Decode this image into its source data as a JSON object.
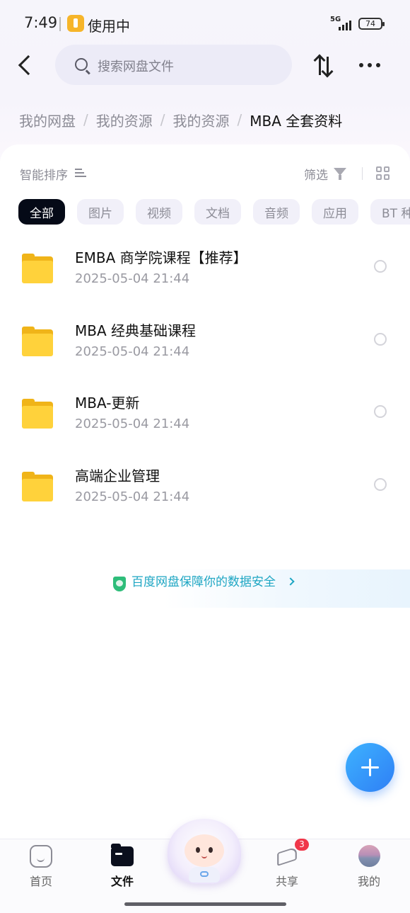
{
  "status_bar": {
    "time": "7:49",
    "app_label": "使用中",
    "network": "5G",
    "battery": "74"
  },
  "header": {
    "search_placeholder": "搜索网盘文件"
  },
  "breadcrumb": [
    "我的网盘",
    "我的资源",
    "我的资源",
    "MBA 全套资料"
  ],
  "toolbar": {
    "sort_label": "智能排序",
    "filter_label": "筛选"
  },
  "chips": [
    "全部",
    "图片",
    "视频",
    "文档",
    "音频",
    "应用",
    "BT 种"
  ],
  "files": [
    {
      "name": "EMBA 商学院课程【推荐】",
      "date": "2025-05-04  21:44"
    },
    {
      "name": "MBA 经典基础课程",
      "date": "2025-05-04  21:44"
    },
    {
      "name": "MBA-更新",
      "date": "2025-05-04  21:44"
    },
    {
      "name": "高端企业管理",
      "date": "2025-05-04  21:44"
    }
  ],
  "security": {
    "text": "百度网盘保障你的数据安全"
  },
  "bottom_nav": {
    "home": "首页",
    "files": "文件",
    "share": "共享",
    "share_badge": "3",
    "me": "我的"
  },
  "colors": {
    "accent_blue": "#2f7ff5",
    "active_chip": "#050a17",
    "folder_yellow": "#ffd23b",
    "security_teal": "#1ea6c3",
    "badge_red": "#f0374a"
  }
}
